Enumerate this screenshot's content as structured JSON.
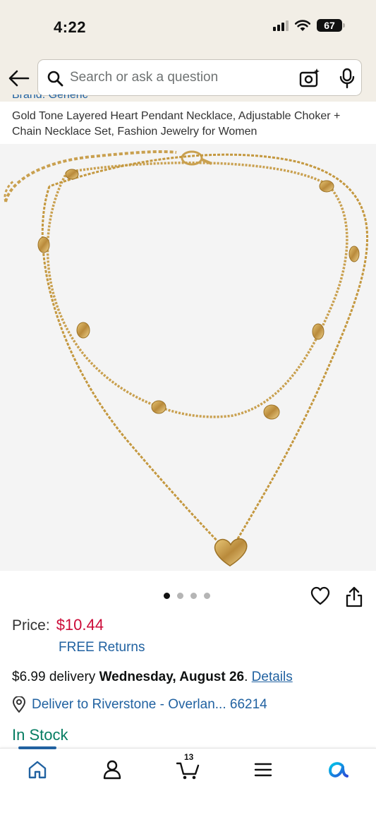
{
  "status_bar": {
    "time": "4:22",
    "battery": "67",
    "icons": [
      "signal-icon",
      "wifi-icon",
      "battery-icon"
    ]
  },
  "search": {
    "placeholder": "Search or ask a question",
    "icons": [
      "back-arrow-icon",
      "search-icon",
      "camera-icon",
      "microphone-icon"
    ]
  },
  "product": {
    "brand_line": "Brand: Generic",
    "title": "Gold Tone Layered Heart Pendant Necklace, Adjustable Choker + Chain Necklace Set, Fashion Jewelry for Women",
    "image_count": 4,
    "active_image_index": 0
  },
  "pricing": {
    "price_label": "Price:",
    "price_value": "$10.44",
    "returns_link": "FREE Returns"
  },
  "delivery": {
    "cost": "$6.99 delivery",
    "date": "Wednesday, August 26",
    "after_date": ".",
    "details_link": "Details",
    "location": "Deliver to Riverstone - Overlan... 66214"
  },
  "stock": {
    "status": "In Stock"
  },
  "bottom_nav": {
    "cart_count": "13",
    "items": [
      "home-icon",
      "account-icon",
      "cart-icon",
      "menu-icon",
      "assistant-icon"
    ]
  },
  "colors": {
    "price": "#cc0c39",
    "link": "#2162a1",
    "in_stock": "#067d62",
    "header_bg": "#f2eee6"
  }
}
